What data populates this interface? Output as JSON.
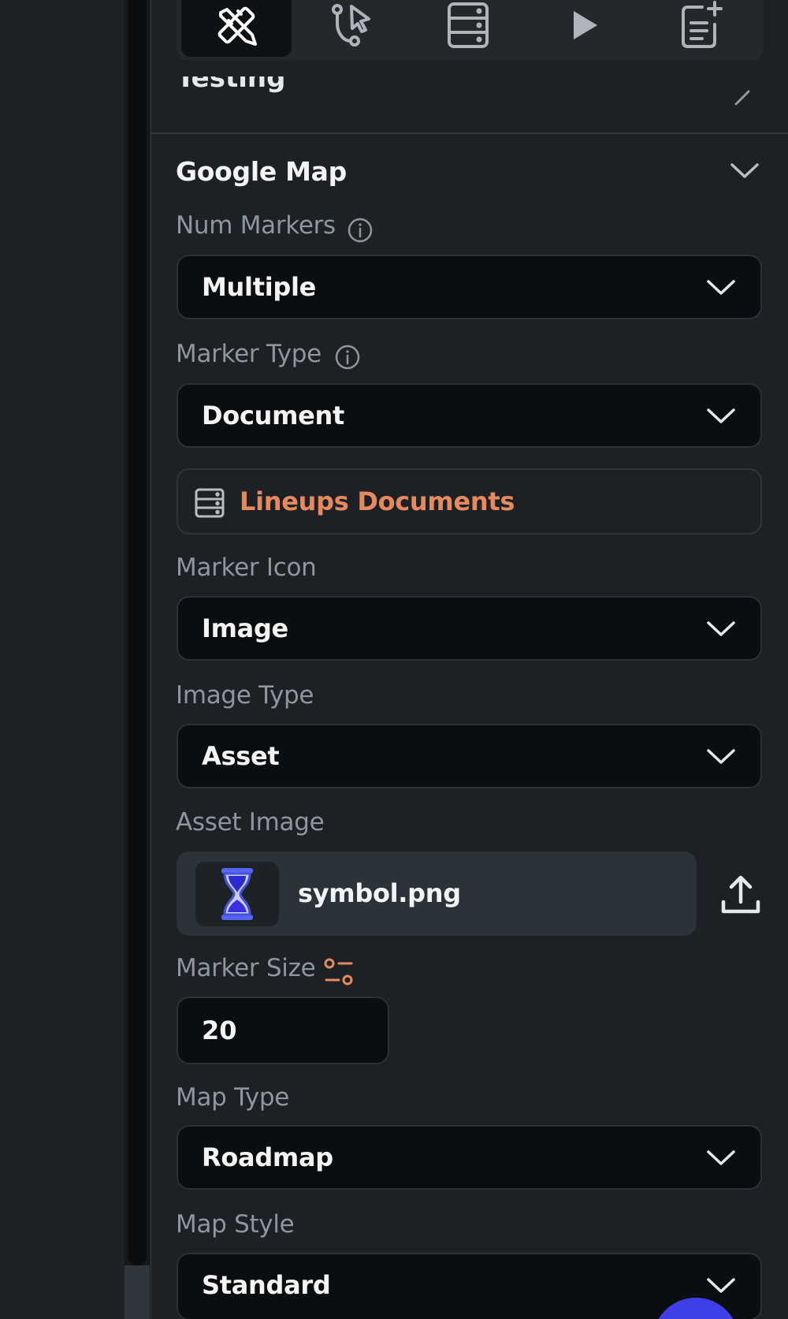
{
  "colors": {
    "background": "#1d2125",
    "field_background": "#0b0e11",
    "label": "#8e969e",
    "collection_accent": "#e6895e",
    "fab_accent": "#3f3fe8"
  },
  "toolbar": {
    "tools": [
      {
        "icon": "design-tools-icon",
        "active": true
      },
      {
        "icon": "actions-flow-icon",
        "active": false
      },
      {
        "icon": "database-icon",
        "active": false
      },
      {
        "icon": "play-icon",
        "active": false
      },
      {
        "icon": "add-document-icon",
        "active": false
      }
    ]
  },
  "previous_section": {
    "title": "Testing"
  },
  "section": {
    "title": "Google Map",
    "fields": {
      "num_markers": {
        "label": "Num Markers",
        "value": "Multiple"
      },
      "marker_type": {
        "label": "Marker Type",
        "value": "Document"
      },
      "collection": {
        "value": "Lineups Documents"
      },
      "marker_icon": {
        "label": "Marker Icon",
        "value": "Image"
      },
      "image_type": {
        "label": "Image Type",
        "value": "Asset"
      },
      "asset_image": {
        "label": "Asset Image",
        "file_name": "symbol.png"
      },
      "marker_size": {
        "label": "Marker Size",
        "value": "20"
      },
      "map_type": {
        "label": "Map Type",
        "value": "Roadmap"
      },
      "map_style": {
        "label": "Map Style",
        "value": "Standard"
      }
    }
  }
}
